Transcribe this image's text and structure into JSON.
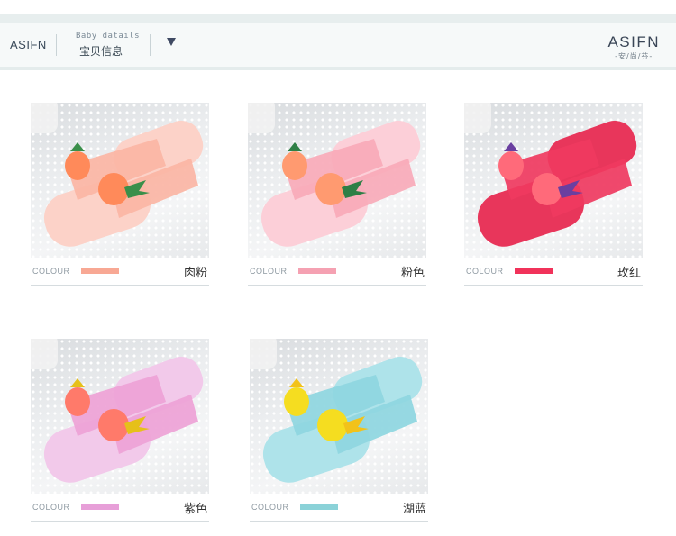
{
  "header": {
    "brand_left": "ASIFN",
    "subtitle_en": "Baby datails",
    "subtitle_cn": "宝贝信息",
    "logo": "ASIFN",
    "logo_sub": "-安/尚/芬-"
  },
  "colour_label": "COLOUR",
  "products": [
    {
      "name": "肉粉",
      "swatch": "#f8a894",
      "strap": "#fbb5a4",
      "sole": "#fcd2c8",
      "fruit": "#ff8a5a",
      "fruit_top": "#3a8f4a"
    },
    {
      "name": "粉色",
      "swatch": "#f5a1b2",
      "strap": "#f9aab8",
      "sole": "#fccfd8",
      "fruit": "#ff9a70",
      "fruit_top": "#2e7f46"
    },
    {
      "name": "玫红",
      "swatch": "#f1325a",
      "strap": "#ef3a60",
      "sole": "#e8365b",
      "fruit": "#ff6a7a",
      "fruit_top": "#6a3fa0"
    },
    {
      "name": "紫色",
      "swatch": "#e79fd8",
      "strap": "#eea2d6",
      "sole": "#f2c9ea",
      "fruit": "#ff7a6a",
      "fruit_top": "#e6c01a"
    },
    {
      "name": "湖蓝",
      "swatch": "#8bd2d8",
      "strap": "#8ed6e0",
      "sole": "#aee3ea",
      "fruit": "#f5dd20",
      "fruit_top": "#f2c21a"
    }
  ]
}
